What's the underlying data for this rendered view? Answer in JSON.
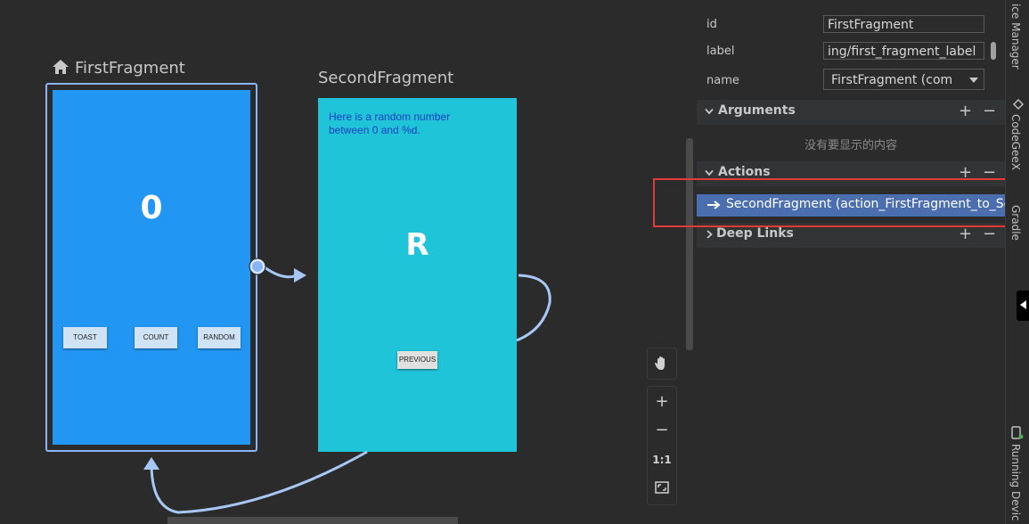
{
  "canvas": {
    "first_fragment": {
      "title": "FirstFragment",
      "counter": "0",
      "buttons": [
        "TOAST",
        "COUNT",
        "RANDOM"
      ]
    },
    "second_fragment": {
      "title": "SecondFragment",
      "random_text": "Here is a random number between 0 and %d.",
      "letter": "R",
      "previous_button": "PREVIOUS"
    },
    "tools": {
      "pan_icon": "hand-icon",
      "zoom_in": "+",
      "zoom_out": "−",
      "actual_size": "1:1",
      "fit_icon": "fit-screen-icon"
    }
  },
  "attributes": {
    "id_label": "id",
    "id_value": "FirstFragment",
    "label_label": "label",
    "label_value": "ing/first_fragment_label",
    "name_label": "name",
    "name_value": "FirstFragment (com"
  },
  "sections": {
    "arguments": {
      "title": "Arguments",
      "empty": "没有要显示的内容"
    },
    "actions": {
      "title": "Actions",
      "item": "SecondFragment (action_FirstFragment_to_Sec"
    },
    "deep_links": {
      "title": "Deep Links"
    },
    "add": "+",
    "remove": "−"
  },
  "side_tabs": {
    "device_manager": "ice Manager",
    "codegeex": "CodeGeeX",
    "gradle": "Gradle",
    "running_devices": "Running Devic"
  },
  "colors": {
    "first_fragment_bg": "#2196f3",
    "second_fragment_bg": "#20c4d8",
    "selection": "#8ab4f8",
    "action_selected": "#4b6eaf",
    "highlight_box": "#e53935"
  }
}
